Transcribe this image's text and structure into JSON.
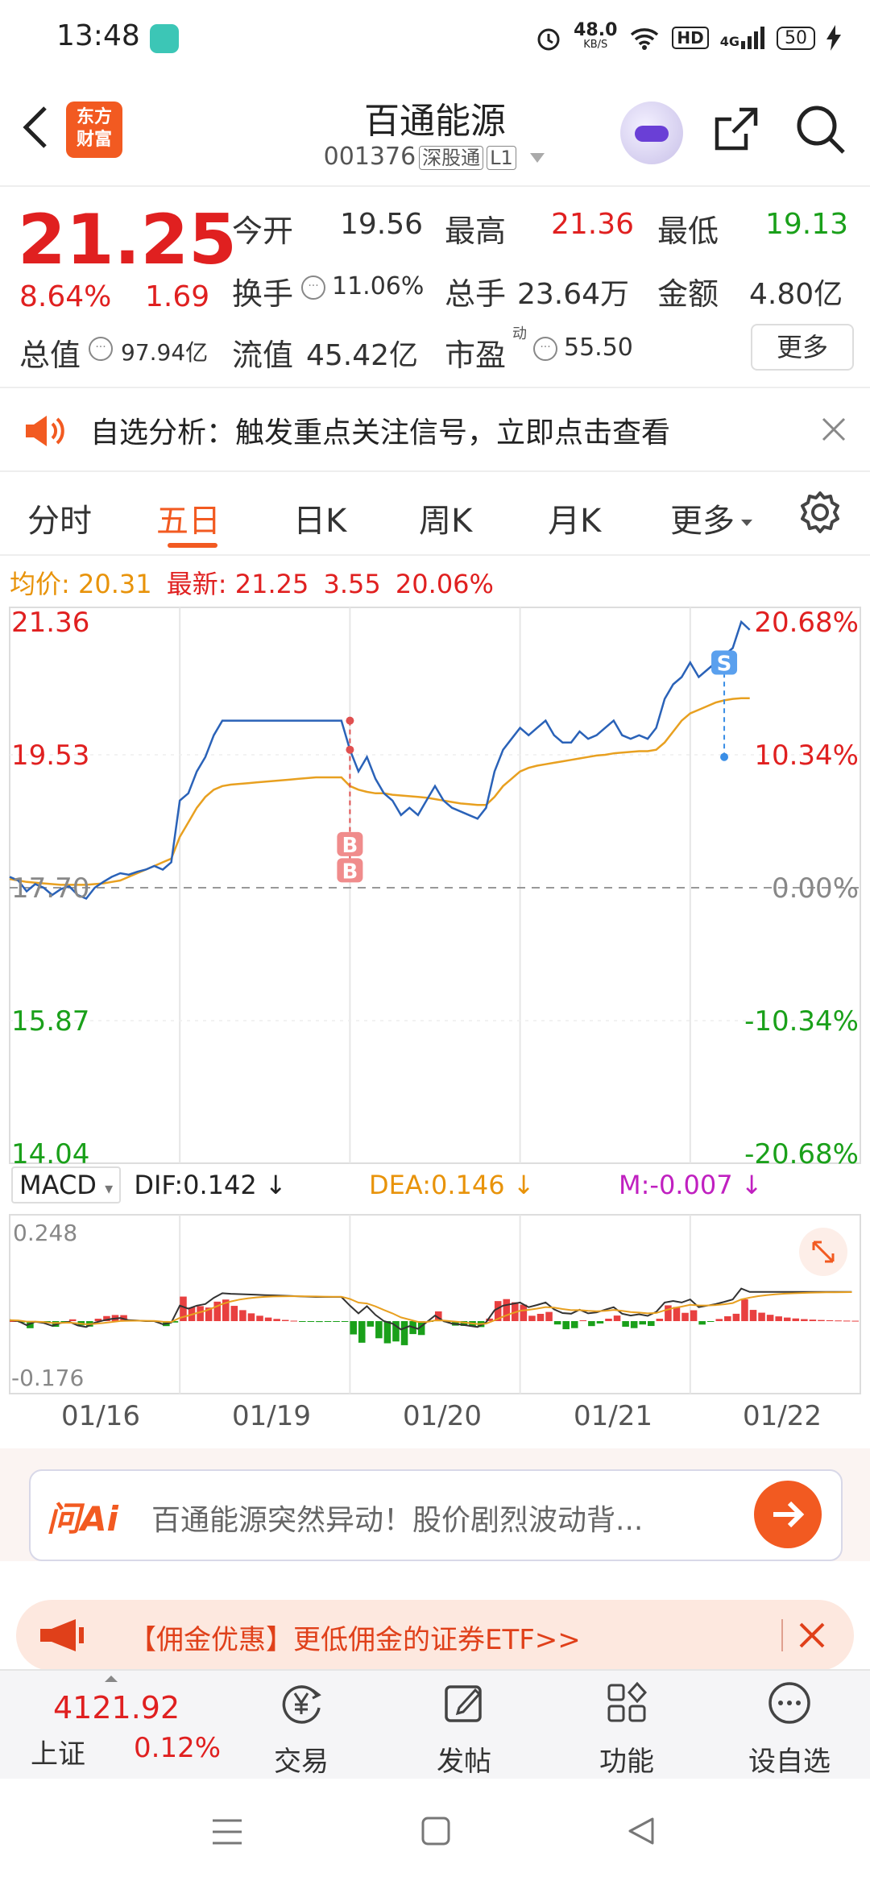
{
  "status_bar": {
    "time": "13:48",
    "net_speed_value": "48.0",
    "net_speed_unit": "KB/S",
    "hd": "HD",
    "signal": "4G",
    "battery": "50"
  },
  "header": {
    "logo_line1": "东方",
    "logo_line2": "财富",
    "title": "百通能源",
    "code": "001376",
    "tag1": "深股通",
    "tag2": "L1"
  },
  "quote": {
    "price": "21.25",
    "change_pct": "8.64%",
    "change": "1.69",
    "open_label": "今开",
    "open": "19.56",
    "high_label": "最高",
    "high": "21.36",
    "low_label": "最低",
    "low": "19.13",
    "turnover_label": "换手",
    "turnover": "11.06%",
    "volume_label": "总手",
    "volume": "23.64万",
    "amount_label": "金额",
    "amount": "4.80亿",
    "mktcap_label": "总值",
    "mktcap": "97.94亿",
    "float_label": "流值",
    "float": "45.42亿",
    "pe_label": "市盈",
    "pe_sup": "动",
    "pe": "55.50",
    "more": "更多"
  },
  "alert": {
    "text": "自选分析：触发重点关注信号，立即点击查看"
  },
  "tabs": [
    {
      "label": "分时"
    },
    {
      "label": "五日"
    },
    {
      "label": "日K"
    },
    {
      "label": "周K"
    },
    {
      "label": "月K"
    },
    {
      "label": "更多"
    }
  ],
  "avg_bar": {
    "avg_label": "均价:",
    "avg": "20.31",
    "latest_label": "最新:",
    "latest": "21.25",
    "chg": "3.55",
    "pct": "20.06%"
  },
  "chart_data": {
    "type": "line",
    "x_days": [
      "01/16",
      "01/19",
      "01/20",
      "01/21",
      "01/22"
    ],
    "y_left_ticks": [
      "21.36",
      "19.53",
      "17.70",
      "15.87",
      "14.04"
    ],
    "y_right_ticks": [
      "20.68%",
      "10.34%",
      "0.00%",
      "-10.34%",
      "-20.68%"
    ],
    "prev_close": 17.7,
    "ylim": [
      14.04,
      21.36
    ],
    "series": [
      {
        "values": [
          17.85,
          17.8,
          17.65,
          17.75,
          17.7,
          17.6,
          17.68,
          17.72,
          17.6,
          17.55,
          17.7,
          17.78,
          17.85,
          17.9,
          17.88,
          17.92,
          17.95,
          18.0,
          17.95,
          18.05,
          18.9,
          19.0,
          19.3,
          19.5,
          19.8,
          20.0,
          20.0,
          20.0,
          20.0,
          20.0,
          20.0,
          20.0,
          20.0,
          20.0,
          20.0,
          20.0,
          20.0,
          20.0,
          20.0,
          20.0,
          19.6,
          19.3,
          19.5,
          19.2,
          19.0,
          18.9,
          18.7,
          18.8,
          18.7,
          18.9,
          19.1,
          18.9,
          18.8,
          18.75,
          18.7,
          18.65,
          18.8,
          19.3,
          19.6,
          19.75,
          19.9,
          19.8,
          19.9,
          20.0,
          19.8,
          19.7,
          19.7,
          19.85,
          19.75,
          19.8,
          19.9,
          20.0,
          19.8,
          19.75,
          19.8,
          19.75,
          19.9,
          20.3,
          20.5,
          20.6,
          20.8,
          20.6,
          20.7,
          20.8,
          20.9,
          21.0,
          21.36,
          21.25
        ]
      },
      {
        "values": [
          17.82,
          17.8,
          17.78,
          17.77,
          17.76,
          17.75,
          17.74,
          17.74,
          17.74,
          17.74,
          17.75,
          17.76,
          17.78,
          17.8,
          17.85,
          17.9,
          17.95,
          18.0,
          18.05,
          18.1,
          18.4,
          18.6,
          18.8,
          18.95,
          19.05,
          19.1,
          19.12,
          19.13,
          19.14,
          19.15,
          19.16,
          19.17,
          19.18,
          19.19,
          19.2,
          19.21,
          19.22,
          19.22,
          19.22,
          19.22,
          19.1,
          19.05,
          19.02,
          19.0,
          19.0,
          18.98,
          18.97,
          18.96,
          18.95,
          18.94,
          18.92,
          18.9,
          18.88,
          18.86,
          18.85,
          18.84,
          18.84,
          18.95,
          19.1,
          19.2,
          19.3,
          19.35,
          19.38,
          19.4,
          19.42,
          19.44,
          19.46,
          19.48,
          19.5,
          19.52,
          19.53,
          19.55,
          19.56,
          19.57,
          19.58,
          19.58,
          19.6,
          19.7,
          19.85,
          20.0,
          20.1,
          20.15,
          20.2,
          20.25,
          20.28,
          20.3,
          20.31,
          20.31
        ]
      }
    ],
    "markers": [
      {
        "label": "B"
      },
      {
        "label": "B"
      },
      {
        "label": "S"
      }
    ]
  },
  "macd": {
    "name": "MACD",
    "dif": "DIF:0.142",
    "dea": "DEA:0.146",
    "m": "M:-0.007",
    "top": "0.248",
    "bottom": "-0.176"
  },
  "ai_bar": {
    "logo": "问Ai",
    "text": "百通能源突然异动！股价剧烈波动背..."
  },
  "promo": {
    "text": "【佣金优惠】更低佣金的证券ETF>>"
  },
  "bottom_nav": {
    "index_value": "4121.92",
    "index_name": "上证",
    "index_pct": "0.12%",
    "items": [
      {
        "label": "交易"
      },
      {
        "label": "发帖"
      },
      {
        "label": "功能"
      },
      {
        "label": "设自选"
      }
    ]
  },
  "colors": {
    "up": "#e02020",
    "down": "#1aa01a",
    "accent": "#f25a21",
    "price_line": "#2a62b8",
    "avg_line": "#e8a020"
  }
}
